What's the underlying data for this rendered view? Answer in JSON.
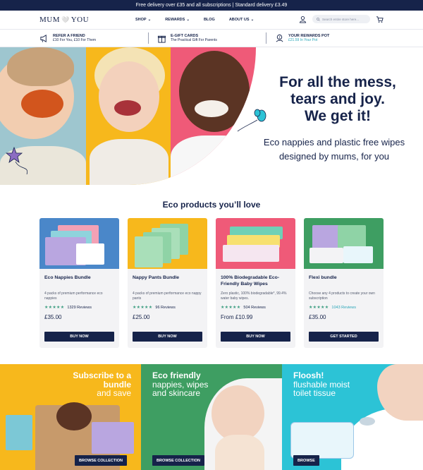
{
  "topbar": {
    "text": "Free delivery over £35 and all subscriptions | Standard delivery £3.49"
  },
  "nav": {
    "logo_left": "MUM",
    "logo_right": "YOU",
    "items": [
      {
        "label": "SHOP",
        "dropdown": true
      },
      {
        "label": "REWARDS",
        "dropdown": true
      },
      {
        "label": "BLOG",
        "dropdown": false
      },
      {
        "label": "ABOUT US",
        "dropdown": true
      }
    ],
    "search_placeholder": "Search entire store here..."
  },
  "promos": [
    {
      "title": "REFER A FRIEND",
      "sub": "£10 For You, £10 For Them",
      "icon": "megaphone-icon"
    },
    {
      "title": "E-GIFT CARDS",
      "sub": "The Practical Gift For Parents",
      "icon": "gift-icon"
    },
    {
      "title": "YOUR REWARDS POT",
      "sub": "£21.59 In Your Pot",
      "icon": "rewards-pot-icon"
    }
  ],
  "hero": {
    "title_line1": "For all the mess,",
    "title_line2": "tears and joy.",
    "title_line3": "We get it!",
    "sub_line1": "Eco nappies and plastic free wipes",
    "sub_line2": "designed by mums, for you"
  },
  "products_section": {
    "title": "Eco products you’ll love"
  },
  "products": [
    {
      "name": "Eco Nappies Bundle",
      "desc": "4 packs of premium performance eco nappies",
      "stars": "★★★★★",
      "reviews": "1329  Reviews",
      "price": "£35.00",
      "button": "BUY NOW",
      "bg": "#4a87c9"
    },
    {
      "name": "Nappy Pants Bundle",
      "desc": "4 packs of premium performance eco nappy pants",
      "stars": "★★★★★",
      "reviews": "96  Reviews",
      "price": "£25.00",
      "button": "BUY NOW",
      "bg": "#f7b81c"
    },
    {
      "name": "100% Biodegradable Eco-Friendly Baby Wipes",
      "desc": "Zero plastic, 100% biodegradable*, 99.4% water baby wipes.",
      "stars": "★★★★★",
      "reviews": "504  Reviews",
      "price": "From £10.99",
      "button": "BUY NOW",
      "bg": "#ef5a78"
    },
    {
      "name": "Flexi bundle",
      "desc": "Choose any 4 products to create your own subscription",
      "stars": "★★★★★",
      "reviews": "1043  Reviews",
      "price": "£35.00",
      "button": "GET STARTED",
      "bg": "#3e9e62"
    }
  ],
  "banners": [
    {
      "line1": "Subscribe to a",
      "line2": "bundle",
      "line3": "and save",
      "button": "BROWSE COLLECTION"
    },
    {
      "line1": "Eco friendly",
      "line2": "nappies, wipes",
      "line3": "and skincare",
      "button": "BROWSE COLLECTION"
    },
    {
      "line1": "Floosh!",
      "line2": "flushable moist",
      "line3": "toilet tissue",
      "button": "BROWSE"
    }
  ],
  "colors": {
    "navy": "#16234a",
    "yellow": "#f7b81c",
    "pink": "#ef5a78",
    "green": "#3e9e62",
    "teal": "#2cc3d6",
    "blue": "#4a87c9"
  }
}
